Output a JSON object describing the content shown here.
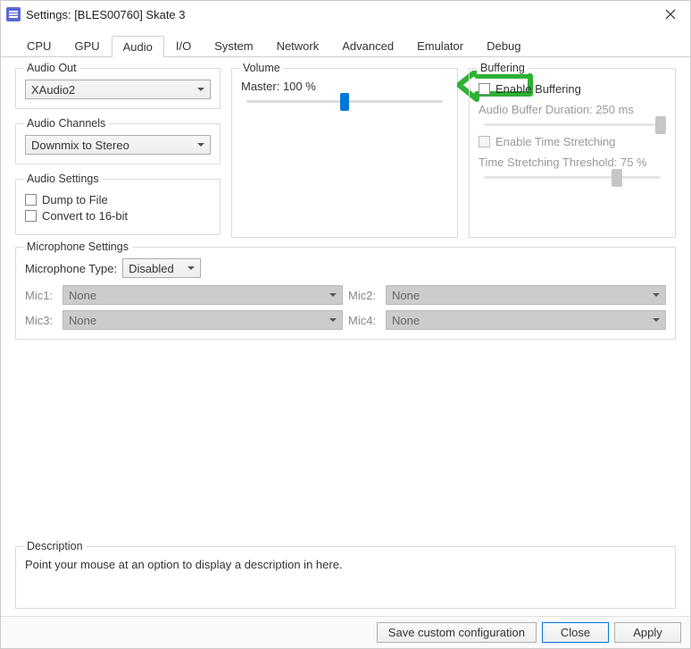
{
  "window": {
    "title": "Settings: [BLES00760] Skate 3"
  },
  "tabs": [
    "CPU",
    "GPU",
    "Audio",
    "I/O",
    "System",
    "Network",
    "Advanced",
    "Emulator",
    "Debug"
  ],
  "activeTab": "Audio",
  "audio": {
    "out": {
      "legend": "Audio Out",
      "value": "XAudio2"
    },
    "channels": {
      "legend": "Audio Channels",
      "value": "Downmix to Stereo"
    },
    "settings": {
      "legend": "Audio Settings",
      "dump": {
        "label": "Dump to File",
        "checked": false
      },
      "convert": {
        "label": "Convert to 16-bit",
        "checked": false
      }
    },
    "volume": {
      "legend": "Volume",
      "master_label": "Master: 100 %",
      "master_percent": 100
    },
    "buffering": {
      "legend": "Buffering",
      "enable": {
        "label": "Enable Buffering",
        "checked": false
      },
      "duration_label": "Audio Buffer Duration: 250 ms",
      "duration_percent": 100,
      "stretch": {
        "label": "Enable Time Stretching",
        "checked": false
      },
      "stretch_label": "Time Stretching Threshold: 75 %",
      "stretch_percent": 75
    }
  },
  "microphone": {
    "legend": "Microphone Settings",
    "type_label": "Microphone Type:",
    "type_value": "Disabled",
    "mics": {
      "mic1": {
        "label": "Mic1:",
        "value": "None"
      },
      "mic2": {
        "label": "Mic2:",
        "value": "None"
      },
      "mic3": {
        "label": "Mic3:",
        "value": "None"
      },
      "mic4": {
        "label": "Mic4:",
        "value": "None"
      }
    }
  },
  "description": {
    "legend": "Description",
    "text": "Point your mouse at an option to display a description in here."
  },
  "footer": {
    "save": "Save custom configuration",
    "close": "Close",
    "apply": "Apply"
  },
  "colors": {
    "accent": "#0078d7",
    "annotation": "#2eb135"
  }
}
